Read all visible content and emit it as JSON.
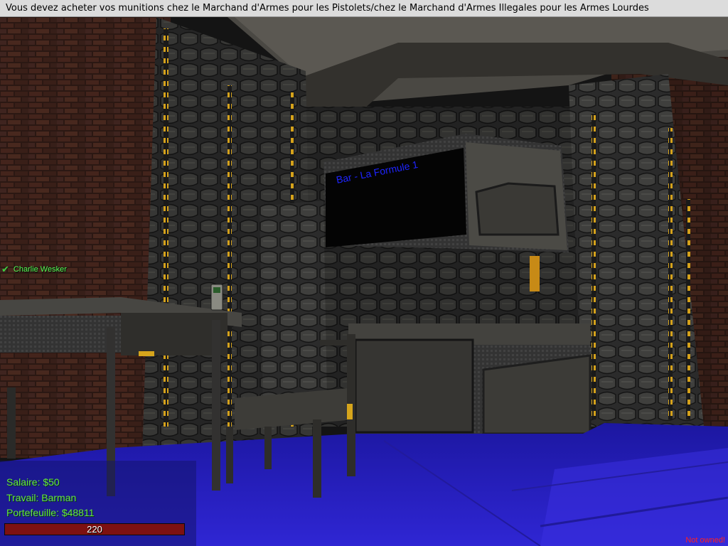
{
  "notice": "Vous devez acheter vos munitions chez le Marchand d'Armes pour les Pistolets/chez le Marchand d'Armes Illegales pour les Armes Lourdes",
  "screen_sign": "Bar - La Formule 1",
  "player_tag": {
    "name": "Charlie Wesker",
    "icon": "checkmark-icon"
  },
  "hud": {
    "salary": "Salaire: $50",
    "job": "Travail: Barman",
    "wallet": "Portefeuille: $48811",
    "health_text": "220",
    "health_fraction": 1.0
  },
  "door_status": "Not owned!",
  "colors": {
    "hud_text": "#66e04a",
    "health_bar": "#7d1111",
    "sign_text": "#1e24ff",
    "floor": "#2a22c8",
    "player_name": "#56ff56",
    "owned_warning": "#ff2020"
  }
}
